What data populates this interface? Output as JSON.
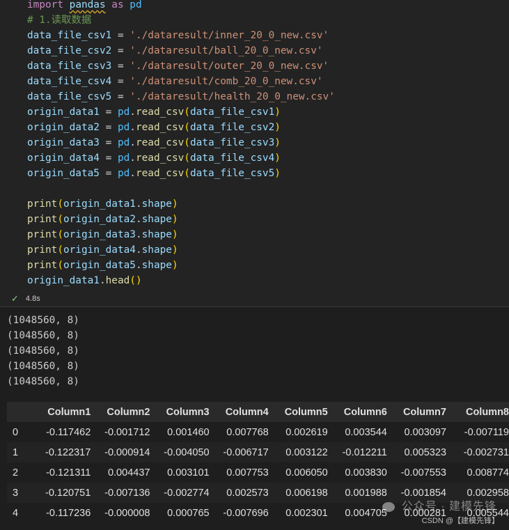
{
  "code_cell": {
    "lines": [
      {
        "tokens": [
          [
            "kw",
            "import "
          ],
          [
            "mod",
            "pandas"
          ],
          [
            "kw",
            " as "
          ],
          [
            "pd",
            "pd"
          ]
        ]
      },
      {
        "tokens": [
          [
            "cm",
            "# 1.读取数据"
          ]
        ]
      },
      {
        "tokens": [
          [
            "var",
            "data_file_csv1"
          ],
          [
            "op",
            " = "
          ],
          [
            "str",
            "'./dataresult/inner_20_0_new.csv'"
          ]
        ]
      },
      {
        "tokens": [
          [
            "var",
            "data_file_csv2"
          ],
          [
            "op",
            " = "
          ],
          [
            "str",
            "'./dataresult/ball_20_0_new.csv'"
          ]
        ]
      },
      {
        "tokens": [
          [
            "var",
            "data_file_csv3"
          ],
          [
            "op",
            " = "
          ],
          [
            "str",
            "'./dataresult/outer_20_0_new.csv'"
          ]
        ]
      },
      {
        "tokens": [
          [
            "var",
            "data_file_csv4"
          ],
          [
            "op",
            " = "
          ],
          [
            "str",
            "'./dataresult/comb_20_0_new.csv'"
          ]
        ]
      },
      {
        "tokens": [
          [
            "var",
            "data_file_csv5"
          ],
          [
            "op",
            " = "
          ],
          [
            "str",
            "'./dataresult/health_20_0_new.csv'"
          ]
        ]
      },
      {
        "tokens": [
          [
            "var",
            "origin_data1"
          ],
          [
            "op",
            " = "
          ],
          [
            "pd",
            "pd"
          ],
          [
            "op",
            "."
          ],
          [
            "fn",
            "read_csv"
          ],
          [
            "pn",
            "("
          ],
          [
            "var",
            "data_file_csv1"
          ],
          [
            "pn",
            ")"
          ]
        ]
      },
      {
        "tokens": [
          [
            "var",
            "origin_data2"
          ],
          [
            "op",
            " = "
          ],
          [
            "pd",
            "pd"
          ],
          [
            "op",
            "."
          ],
          [
            "fn",
            "read_csv"
          ],
          [
            "pn",
            "("
          ],
          [
            "var",
            "data_file_csv2"
          ],
          [
            "pn",
            ")"
          ]
        ]
      },
      {
        "tokens": [
          [
            "var",
            "origin_data3"
          ],
          [
            "op",
            " = "
          ],
          [
            "pd",
            "pd"
          ],
          [
            "op",
            "."
          ],
          [
            "fn",
            "read_csv"
          ],
          [
            "pn",
            "("
          ],
          [
            "var",
            "data_file_csv3"
          ],
          [
            "pn",
            ")"
          ]
        ]
      },
      {
        "tokens": [
          [
            "var",
            "origin_data4"
          ],
          [
            "op",
            " = "
          ],
          [
            "pd",
            "pd"
          ],
          [
            "op",
            "."
          ],
          [
            "fn",
            "read_csv"
          ],
          [
            "pn",
            "("
          ],
          [
            "var",
            "data_file_csv4"
          ],
          [
            "pn",
            ")"
          ]
        ]
      },
      {
        "tokens": [
          [
            "var",
            "origin_data5"
          ],
          [
            "op",
            " = "
          ],
          [
            "pd",
            "pd"
          ],
          [
            "op",
            "."
          ],
          [
            "fn",
            "read_csv"
          ],
          [
            "pn",
            "("
          ],
          [
            "var",
            "data_file_csv5"
          ],
          [
            "pn",
            ")"
          ]
        ]
      },
      {
        "tokens": []
      },
      {
        "tokens": [
          [
            "fn",
            "print"
          ],
          [
            "pn",
            "("
          ],
          [
            "var",
            "origin_data1"
          ],
          [
            "op",
            "."
          ],
          [
            "var",
            "shape"
          ],
          [
            "pn",
            ")"
          ]
        ]
      },
      {
        "tokens": [
          [
            "fn",
            "print"
          ],
          [
            "pn",
            "("
          ],
          [
            "var",
            "origin_data2"
          ],
          [
            "op",
            "."
          ],
          [
            "var",
            "shape"
          ],
          [
            "pn",
            ")"
          ]
        ]
      },
      {
        "tokens": [
          [
            "fn",
            "print"
          ],
          [
            "pn",
            "("
          ],
          [
            "var",
            "origin_data3"
          ],
          [
            "op",
            "."
          ],
          [
            "var",
            "shape"
          ],
          [
            "pn",
            ")"
          ]
        ]
      },
      {
        "tokens": [
          [
            "fn",
            "print"
          ],
          [
            "pn",
            "("
          ],
          [
            "var",
            "origin_data4"
          ],
          [
            "op",
            "."
          ],
          [
            "var",
            "shape"
          ],
          [
            "pn",
            ")"
          ]
        ]
      },
      {
        "tokens": [
          [
            "fn",
            "print"
          ],
          [
            "pn",
            "("
          ],
          [
            "var",
            "origin_data5"
          ],
          [
            "op",
            "."
          ],
          [
            "var",
            "shape"
          ],
          [
            "pn",
            ")"
          ]
        ]
      },
      {
        "tokens": [
          [
            "var",
            "origin_data1"
          ],
          [
            "op",
            "."
          ],
          [
            "fn",
            "head"
          ],
          [
            "pn",
            "()"
          ]
        ]
      }
    ],
    "run_time": "4.8s"
  },
  "stdout_lines": [
    "(1048560, 8)",
    "(1048560, 8)",
    "(1048560, 8)",
    "(1048560, 8)",
    "(1048560, 8)"
  ],
  "dataframe": {
    "columns": [
      "Column1",
      "Column2",
      "Column3",
      "Column4",
      "Column5",
      "Column6",
      "Column7",
      "Column8"
    ],
    "rows": [
      {
        "index": "0",
        "values": [
          "-0.117462",
          "-0.001712",
          "0.001460",
          "0.007768",
          "0.002619",
          "0.003544",
          "0.003097",
          "-0.007119"
        ]
      },
      {
        "index": "1",
        "values": [
          "-0.122317",
          "-0.000914",
          "-0.004050",
          "-0.006717",
          "0.003122",
          "-0.012211",
          "0.005323",
          "-0.002731"
        ]
      },
      {
        "index": "2",
        "values": [
          "-0.121311",
          "0.004437",
          "0.003101",
          "0.007753",
          "0.006050",
          "0.003830",
          "-0.007553",
          "0.008774"
        ]
      },
      {
        "index": "3",
        "values": [
          "-0.120751",
          "-0.007136",
          "-0.002774",
          "0.002573",
          "0.006198",
          "0.001988",
          "-0.001854",
          "0.002958"
        ]
      },
      {
        "index": "4",
        "values": [
          "-0.117236",
          "-0.000008",
          "0.000765",
          "-0.007696",
          "0.002301",
          "0.004705",
          "0.000281",
          "0.005544"
        ]
      }
    ]
  },
  "watermark": {
    "icon": "wechat-icon",
    "text": "公众号 · 建模先锋",
    "csdn": "CSDN @【建模先锋】"
  }
}
